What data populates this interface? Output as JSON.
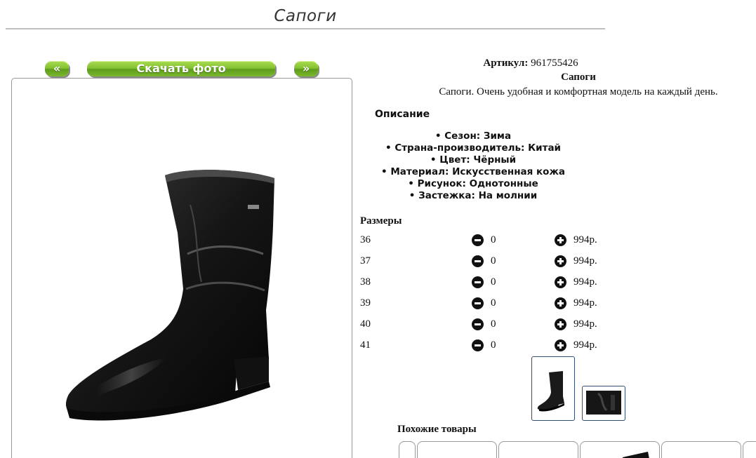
{
  "page": {
    "title": "Сапоги"
  },
  "gallery": {
    "prev_label": "«",
    "download_label": "Скачать фото",
    "next_label": "»"
  },
  "product": {
    "article_label": "Артикул:",
    "article_value": "961755426",
    "name": "Сапоги",
    "short_description": "Сапоги. Очень удобная и комфортная модель на каждый день."
  },
  "description": {
    "heading": "Описание",
    "properties": [
      "Сезон: Зима",
      "Страна-производитель: Китай",
      "Цвет: Чёрный",
      "Материал: Искусственная кожа",
      "Рисунок: Однотонные",
      "Застежка: На молнии"
    ]
  },
  "sizes": {
    "heading": "Размеры",
    "rows": [
      {
        "size": "36",
        "qty": "0",
        "price": "994р."
      },
      {
        "size": "37",
        "qty": "0",
        "price": "994р."
      },
      {
        "size": "38",
        "qty": "0",
        "price": "994р."
      },
      {
        "size": "39",
        "qty": "0",
        "price": "994р."
      },
      {
        "size": "40",
        "qty": "0",
        "price": "994р."
      },
      {
        "size": "41",
        "qty": "0",
        "price": "994р."
      }
    ]
  },
  "similar": {
    "heading": "Похожие товары"
  },
  "icons": {
    "decrease": "minus-circle-icon",
    "increase": "plus-circle-icon"
  },
  "colors": {
    "button_green": "#7cb82e",
    "thumb_border": "#2f4f6f"
  }
}
